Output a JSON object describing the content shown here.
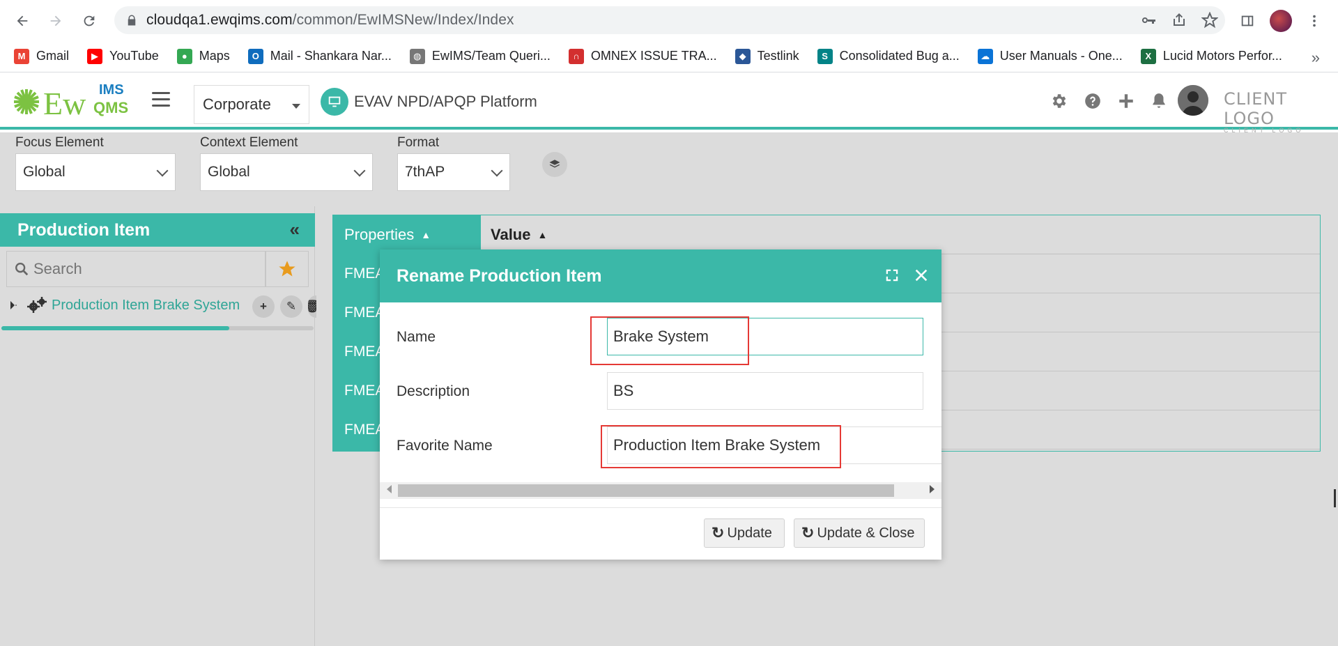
{
  "browser": {
    "url_host": "cloudqa1.ewqims.com",
    "url_path": "/common/EwIMSNew/Index/Index",
    "bookmarks": [
      {
        "label": "Gmail",
        "icon": "gmail-icon",
        "color": "#ea4335",
        "glyph": "M"
      },
      {
        "label": "YouTube",
        "icon": "youtube-icon",
        "color": "#ff0000",
        "glyph": "▶"
      },
      {
        "label": "Maps",
        "icon": "maps-icon",
        "color": "#34a853",
        "glyph": "●"
      },
      {
        "label": "Mail - Shankara Nar...",
        "icon": "outlook-icon",
        "color": "#0f6cbd",
        "glyph": "O"
      },
      {
        "label": "EwIMS/Team Queri...",
        "icon": "globe-icon",
        "color": "#777777",
        "glyph": "◍"
      },
      {
        "label": "OMNEX ISSUE TRA...",
        "icon": "omnex-icon",
        "color": "#d32f2f",
        "glyph": "∩"
      },
      {
        "label": "Testlink",
        "icon": "testlink-icon",
        "color": "#2b5797",
        "glyph": "◆"
      },
      {
        "label": "Consolidated Bug a...",
        "icon": "sharepoint-icon",
        "color": "#038387",
        "glyph": "S"
      },
      {
        "label": "User Manuals - One...",
        "icon": "onedrive-icon",
        "color": "#0a73d6",
        "glyph": "☁"
      },
      {
        "label": "Lucid Motors Perfor...",
        "icon": "excel-icon",
        "color": "#1d6f42",
        "glyph": "X"
      }
    ],
    "more": "»"
  },
  "header": {
    "logo_text": "Ew",
    "logo_sup_top": "IMS",
    "logo_sup_bottom": "QMS",
    "org_select": "Corporate",
    "platform_title": "EVAV NPD/APQP Platform",
    "client_logo": "CLIENT LOGO",
    "client_logo_sub": "CLIENT LOGO",
    "accent": "#3bb8a8"
  },
  "filters": {
    "focus_label": "Focus Element",
    "focus_value": "Global",
    "context_label": "Context Element",
    "context_value": "Global",
    "format_label": "Format",
    "format_value": "7thAP"
  },
  "left_panel": {
    "title": "Production Item",
    "collapse": "«",
    "search_placeholder": "Search",
    "tree_item": "Production Item Brake System",
    "tree_actions": [
      "+",
      "✎",
      "🗑"
    ],
    "progress": 0.73
  },
  "properties": {
    "col_properties": "Properties",
    "col_value": "Value",
    "rows": [
      "FMEA",
      "FMEA",
      "FMEA",
      "FMEA",
      "FMEA"
    ]
  },
  "modal": {
    "title": "Rename Production Item",
    "name_label": "Name",
    "name_value": "Brake System",
    "description_label": "Description",
    "description_value": "BS",
    "favorite_label": "Favorite Name",
    "favorite_value": "Production Item Brake System",
    "update_label": "Update",
    "update_close_label": "Update & Close"
  }
}
